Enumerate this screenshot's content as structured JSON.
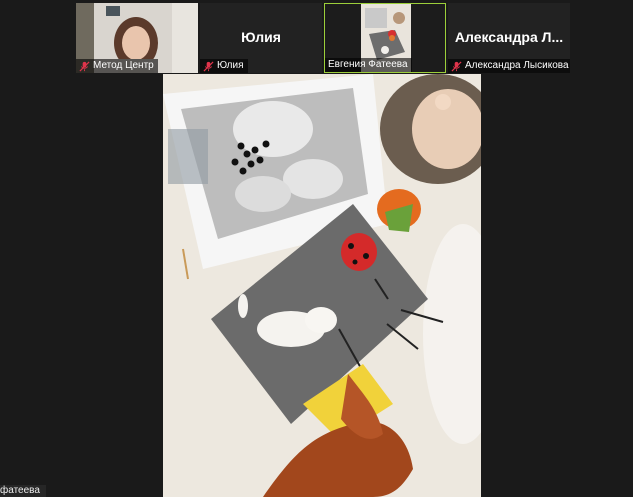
{
  "participants": [
    {
      "id": "metod",
      "name": "Метод Центр",
      "big_name": ""
    },
    {
      "id": "yulia",
      "name": "Юлия",
      "big_name": "Юлия"
    },
    {
      "id": "evgenia",
      "name": "Евгения Фатеева",
      "big_name": ""
    },
    {
      "id": "alexandra",
      "name": "Александра Лысикова",
      "big_name": "Александра Л..."
    }
  ],
  "active_speaker": "Евгения Фатеева",
  "main_video_label": "фатеева",
  "colors": {
    "active_border": "#9ccf3a",
    "mic_muted": "#e0344b",
    "background": "#1a1a1a"
  },
  "icons": [
    "mic-muted-icon"
  ]
}
